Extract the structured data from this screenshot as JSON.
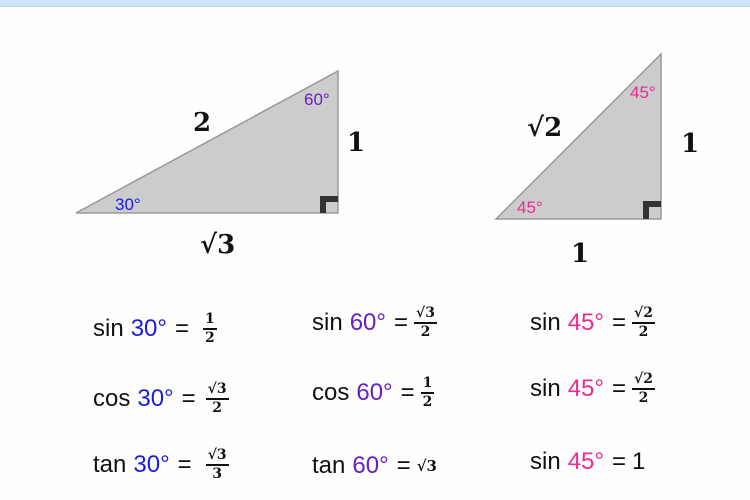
{
  "colors": {
    "angle30": "#1a1ae6",
    "angle60": "#6a1fc4",
    "angle45": "#ee2b8f",
    "triangleFill": "#cccccc",
    "triangleStroke": "#999999",
    "rightAngleMarker": "#333333",
    "topBar": "#cfe3fa"
  },
  "triangle_30_60_90": {
    "hypotenuse": "2",
    "opposite": "1",
    "adjacent": "√3",
    "angle_bottom_left": "30°",
    "angle_top": "60°"
  },
  "triangle_45_45_90": {
    "hypotenuse": "√2",
    "vertical_leg": "1",
    "horizontal_leg": "1",
    "angle_bottom_left": "45°",
    "angle_top": "45°"
  },
  "equations": [
    {
      "fn": "sin",
      "angle": "30°",
      "equals": "=",
      "num": "1",
      "den": "2"
    },
    {
      "fn": "cos",
      "angle": "30°",
      "equals": "=",
      "num": "√3",
      "den": "2"
    },
    {
      "fn": "tan",
      "angle": "30°",
      "equals": "=",
      "num": "√3",
      "den": "3"
    },
    {
      "fn": "sin",
      "angle": "60°",
      "equals": "=",
      "num": "√3",
      "den": "2"
    },
    {
      "fn": "cos",
      "angle": "60°",
      "equals": "=",
      "num": "1",
      "den": "2"
    },
    {
      "fn": "tan",
      "angle": "60°",
      "equals": "=",
      "value": "√3"
    },
    {
      "fn": "sin",
      "angle": "45°",
      "equals": "=",
      "num": "√2",
      "den": "2"
    },
    {
      "fn": "sin",
      "angle": "45°",
      "equals": "=",
      "num": "√2",
      "den": "2"
    },
    {
      "fn": "sin",
      "angle": "45°",
      "equals": "=",
      "value": "1"
    }
  ]
}
